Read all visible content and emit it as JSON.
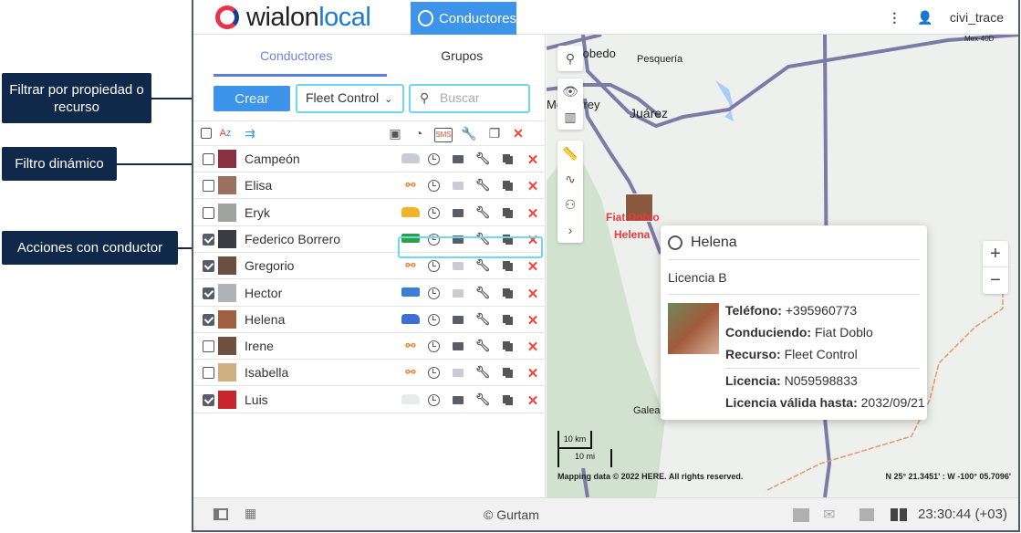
{
  "header": {
    "logo_text": "wialon",
    "logo_text2": "local",
    "nav_button": "Conductores",
    "user": "civi_trace"
  },
  "tabs": [
    {
      "label": "Conductores",
      "active": true
    },
    {
      "label": "Grupos",
      "active": false
    }
  ],
  "controls": {
    "create_label": "Crear",
    "resource_filter": "Fleet Control",
    "search_placeholder": "Buscar"
  },
  "toolbar": {
    "sms_label": "SMS"
  },
  "drivers": [
    {
      "name": "Campeón",
      "checked": false,
      "vehicle": "car",
      "vehicle_color": "#c9cdd3",
      "message_enabled": true,
      "photo": "#8a3040"
    },
    {
      "name": "Elisa",
      "checked": false,
      "vehicle": "unlink",
      "message_enabled": false,
      "photo": "#9a7060"
    },
    {
      "name": "Eryk",
      "checked": false,
      "vehicle": "car",
      "vehicle_color": "#f0b429",
      "message_enabled": true,
      "photo": "#a0a4a0"
    },
    {
      "name": "Federico Borrero",
      "checked": true,
      "vehicle": "bus",
      "vehicle_color": "#2f9e44",
      "message_enabled": true,
      "photo": "#3a3c44"
    },
    {
      "name": "Gregorio",
      "checked": true,
      "vehicle": "unlink",
      "message_enabled": false,
      "photo": "#6a5040"
    },
    {
      "name": "Hector",
      "checked": true,
      "vehicle": "bus",
      "vehicle_color": "#3b7fd4",
      "message_enabled": false,
      "photo": "#b0b4b8"
    },
    {
      "name": "Helena",
      "checked": true,
      "vehicle": "van",
      "vehicle_color": "#3b6fd4",
      "message_enabled": true,
      "photo": "#a06040"
    },
    {
      "name": "Irene",
      "checked": false,
      "vehicle": "unlink",
      "message_enabled": true,
      "photo": "#705040"
    },
    {
      "name": "Isabella",
      "checked": false,
      "vehicle": "unlink",
      "message_enabled": false,
      "photo": "#d0b080"
    },
    {
      "name": "Luis",
      "checked": true,
      "vehicle": "van",
      "vehicle_color": "#e8eaec",
      "message_enabled": true,
      "photo": "#c8282c"
    }
  ],
  "callouts": {
    "filter": "Filtrar por propiedad o recurso",
    "dynamic": "Filtro dinámico",
    "actions": "Acciones con conductor"
  },
  "map": {
    "places": [
      "Escobedo",
      "Pesquería",
      "Monterrey",
      "Juárez",
      "Galeana",
      "Mex-40D"
    ],
    "marker_vehicle": "Fiat Doblo",
    "marker_driver": "Helena",
    "scale_km": "10 km",
    "scale_mi": "10 mi",
    "attribution": "Mapping data © 2022 HERE. All rights reserved.",
    "coords": "N 25° 21.3451' : W -100° 05.7096'"
  },
  "popup": {
    "name": "Helena",
    "license_class": "Licencia B",
    "phone_label": "Teléfono:",
    "phone": "+395960773",
    "driving_label": "Conduciendo:",
    "driving": "Fiat Doblo",
    "resource_label": "Recurso:",
    "resource": "Fleet Control",
    "license_label": "Licencia:",
    "license": "N059598833",
    "valid_label": "Licencia válida hasta:",
    "valid": "2032/09/21"
  },
  "footer": {
    "copyright": "© Gurtam",
    "time": "23:30:44 (+03)"
  }
}
